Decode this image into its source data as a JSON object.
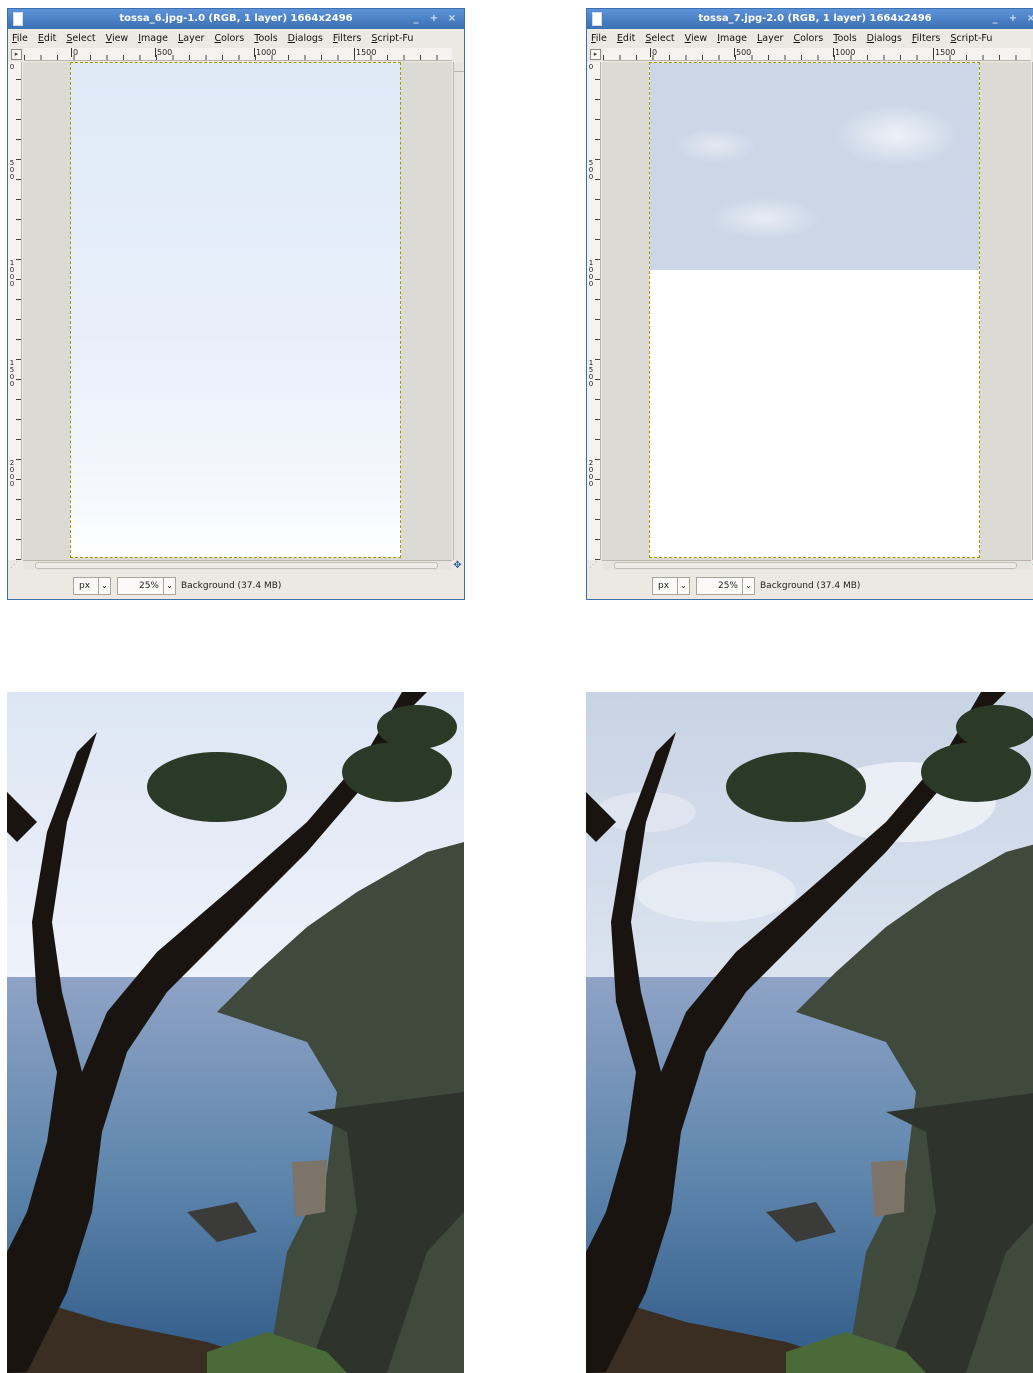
{
  "window_a": {
    "title": "tossa_6.jpg-1.0 (RGB, 1 layer) 1664x2496",
    "controls": [
      "_",
      "+",
      "×"
    ],
    "menu": [
      "File",
      "Edit",
      "Select",
      "View",
      "Image",
      "Layer",
      "Colors",
      "Tools",
      "Dialogs",
      "Filters",
      "Script-Fu"
    ],
    "ruler_h_labels": [
      "0",
      "500",
      "1000",
      "1500"
    ],
    "ruler_v_labels": [
      "0",
      "500",
      "1000",
      "1500",
      "2000"
    ],
    "unit": "px",
    "zoom": "25%",
    "status": "Background (37.4 MB)"
  },
  "window_b": {
    "title": "tossa_7.jpg-2.0 (RGB, 1 layer) 1664x2496",
    "controls": [
      "_",
      "+",
      "×"
    ],
    "menu": [
      "File",
      "Edit",
      "Select",
      "View",
      "Image",
      "Layer",
      "Colors",
      "Tools",
      "Dialogs",
      "Filters",
      "Script-Fu"
    ],
    "ruler_h_labels": [
      "0",
      "500",
      "1000",
      "1500"
    ],
    "ruler_v_labels": [
      "0",
      "500",
      "1000",
      "1500",
      "2000"
    ],
    "unit": "px",
    "zoom": "25%",
    "status": "Background (37.4 MB)"
  },
  "colors": {
    "titlebar": "#3b6fb3",
    "sea": "#5f86ad",
    "cliff": "#3f4a3d",
    "tree": "#1a1410"
  }
}
